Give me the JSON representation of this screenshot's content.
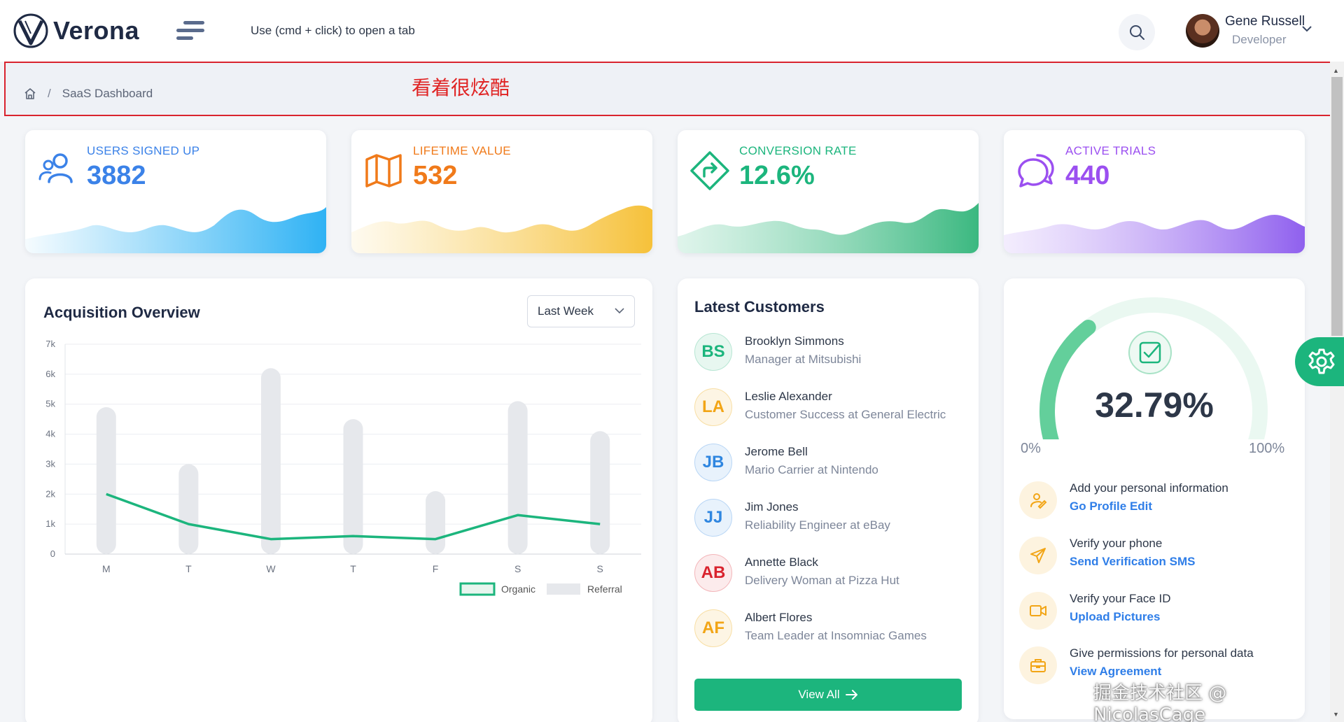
{
  "header": {
    "brand": "Verona",
    "hint": "Use (cmd + click) to open a tab",
    "user": {
      "name": "Gene Russell",
      "role": "Developer"
    }
  },
  "breadcrumb": {
    "page": "SaaS Dashboard",
    "separator": "/"
  },
  "annotation": "看着很炫酷",
  "stats": [
    {
      "label": "USERS SIGNED UP",
      "value": "3882",
      "color": "#3b82e8",
      "icon": "users-icon"
    },
    {
      "label": "LIFETIME VALUE",
      "value": "532",
      "color": "#f07a1a",
      "icon": "map-icon"
    },
    {
      "label": "CONVERSION RATE",
      "value": "12.6%",
      "color": "#1cb57d",
      "icon": "direction-sign-icon"
    },
    {
      "label": "ACTIVE TRIALS",
      "value": "440",
      "color": "#9b4ff0",
      "icon": "chat-bubbles-icon"
    }
  ],
  "acquisition": {
    "title": "Acquisition Overview",
    "period": "Last Week"
  },
  "chart_data": {
    "type": "bar",
    "categories": [
      "M",
      "T",
      "W",
      "T",
      "F",
      "S",
      "S"
    ],
    "series": [
      {
        "name": "Referral",
        "type": "bar",
        "color": "#e6e8ec",
        "values": [
          4900,
          3000,
          6200,
          4500,
          2100,
          5100,
          4100
        ]
      },
      {
        "name": "Organic",
        "type": "line",
        "color": "#1cb57d",
        "values": [
          2000,
          1000,
          500,
          600,
          500,
          1300,
          1000
        ]
      }
    ],
    "y_ticks": [
      "0",
      "1k",
      "2k",
      "3k",
      "4k",
      "5k",
      "6k",
      "7k"
    ],
    "ylim": [
      0,
      7000
    ],
    "grid": true,
    "legend": "bottom-right"
  },
  "customers": {
    "title": "Latest Customers",
    "items": [
      {
        "initials": "BS",
        "name": "Brooklyn Simmons",
        "role": "Manager at Mitsubishi",
        "color": "#1cb57d",
        "bg": "#e7f7f0"
      },
      {
        "initials": "LA",
        "name": "Leslie Alexander",
        "role": "Customer Success at General Electric",
        "color": "#f2a516",
        "bg": "#fdf5e4"
      },
      {
        "initials": "JB",
        "name": "Jerome Bell",
        "role": "Mario Carrier at Nintendo",
        "color": "#2f86e0",
        "bg": "#e8f2fc"
      },
      {
        "initials": "JJ",
        "name": "Jim Jones",
        "role": "Reliability Engineer at eBay",
        "color": "#2f86e0",
        "bg": "#e8f2fc"
      },
      {
        "initials": "AB",
        "name": "Annette Black",
        "role": "Delivery Woman at Pizza Hut",
        "color": "#d9232e",
        "bg": "#fcebec"
      },
      {
        "initials": "AF",
        "name": "Albert Flores",
        "role": "Team Leader at Insomniac Games",
        "color": "#f2a516",
        "bg": "#fdf5e4"
      }
    ],
    "view_all": "View All"
  },
  "profile_progress": {
    "percent_label": "32.79%",
    "percent": 32.79,
    "min": "0%",
    "max": "100%",
    "tasks": [
      {
        "text": "Add your personal information",
        "link": "Go Profile Edit",
        "icon": "user-edit-icon"
      },
      {
        "text": "Verify your phone",
        "link": "Send Verification SMS",
        "icon": "send-icon"
      },
      {
        "text": "Verify your Face ID",
        "link": "Upload Pictures",
        "icon": "video-icon"
      },
      {
        "text": "Give permissions for personal data",
        "link": "View Agreement",
        "icon": "briefcase-icon"
      }
    ]
  },
  "watermark": "掘金技术社区 @ NicolasCage"
}
